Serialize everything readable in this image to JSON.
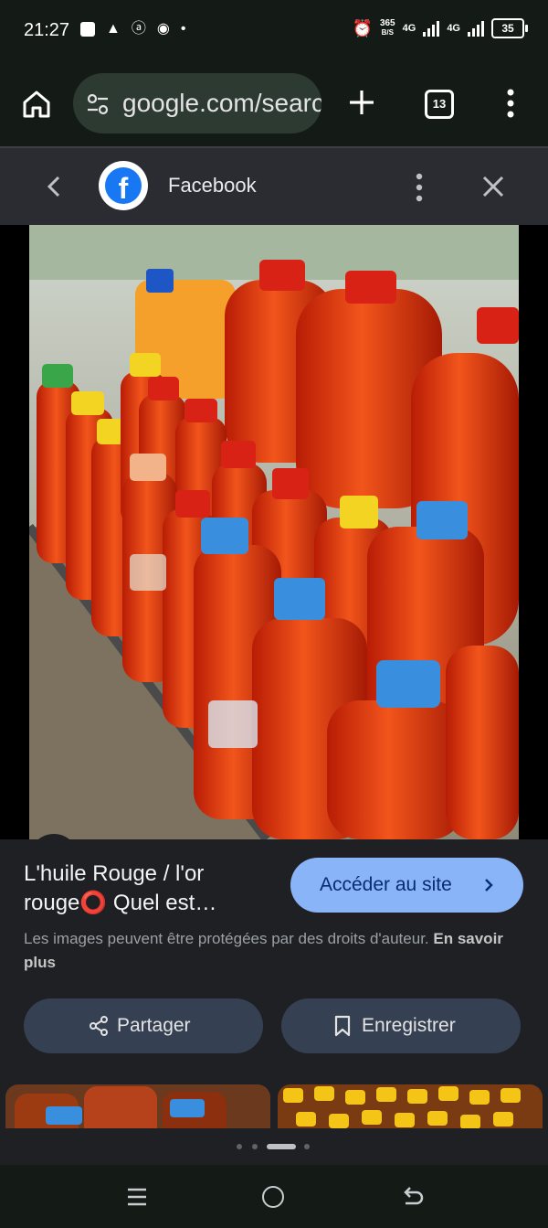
{
  "status_bar": {
    "time": "21:27",
    "left_icons": [
      "notification-square-icon",
      "warning-icon",
      "app-icon",
      "chrome-icon",
      "dot-icon"
    ],
    "speed_value": "365",
    "speed_unit": "B/S",
    "network_1": "4G",
    "network_2": "4G",
    "battery": "35"
  },
  "browser": {
    "url": "google.com/search",
    "tab_count": "13"
  },
  "sheet": {
    "source_name": "Facebook",
    "fb_glyph": "f",
    "title": "L'huile Rouge / l'or rouge⭕ Quel est…",
    "visit_label": "Accéder au site",
    "copyright_text": "Les images peuvent être protégées par des droits d'auteur.",
    "learn_more": "En savoir plus",
    "share_label": "Partager",
    "save_label": "Enregistrer"
  },
  "colors": {
    "accent": "#8ab4f8",
    "pill_bg": "#354152",
    "facebook_blue": "#1877f2"
  }
}
